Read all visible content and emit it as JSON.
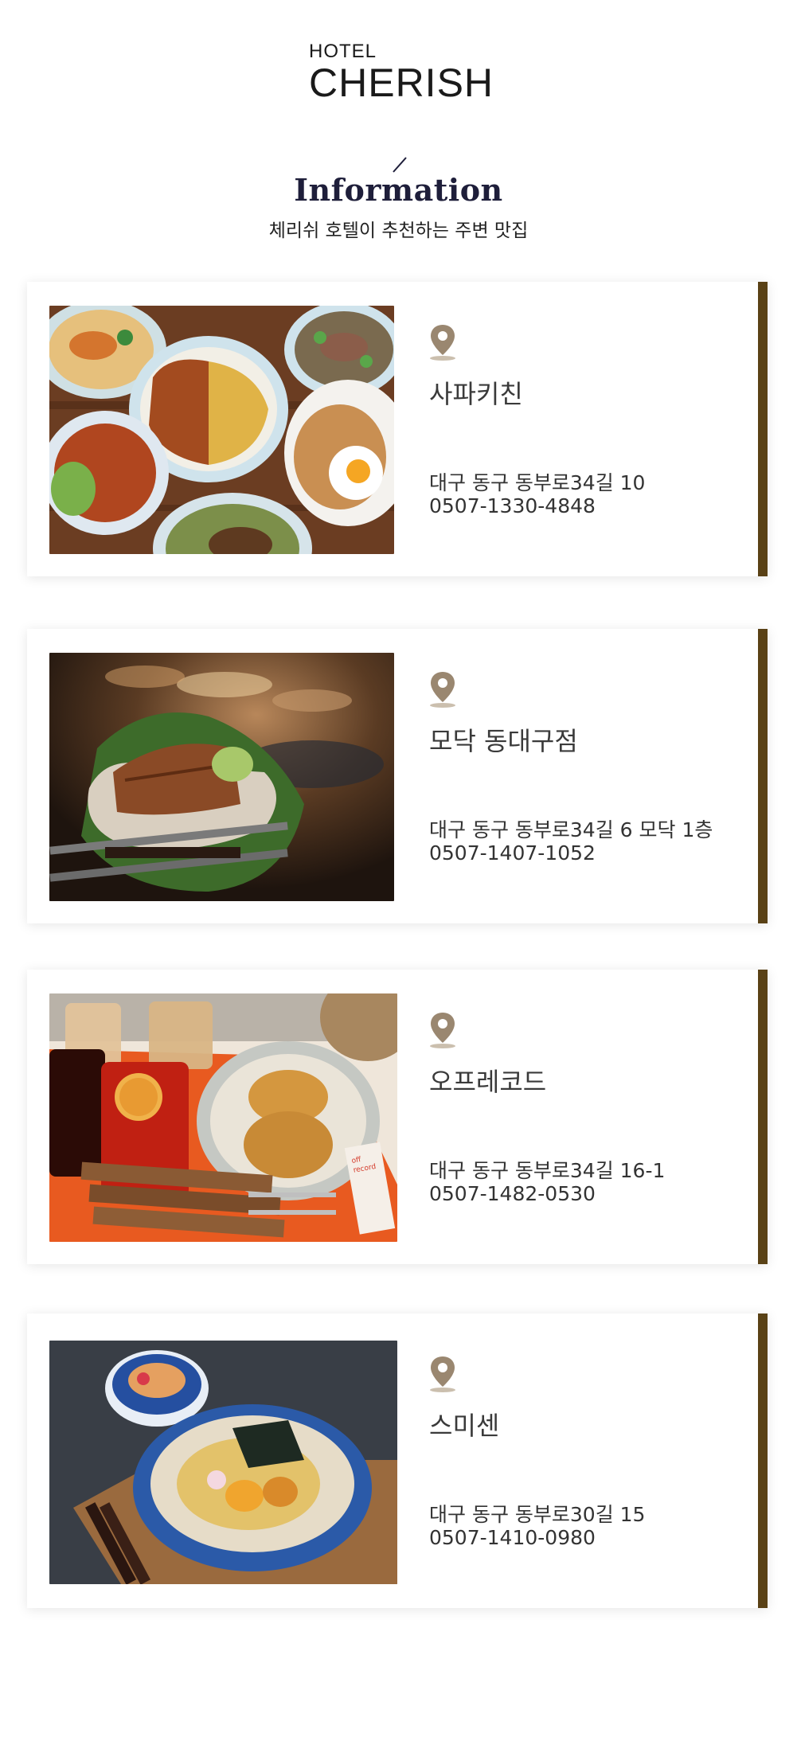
{
  "header": {
    "logo_small": "HOTEL",
    "logo_big": "CHERISH",
    "section_title": "Information",
    "section_subtitle": "체리쉬 호텔이 추천하는 주변 맛집"
  },
  "restaurants": [
    {
      "name": "사파키친",
      "address": "대구 동구 동부로34길 10",
      "phone": "0507-1330-4848"
    },
    {
      "name": "모닥 동대구점",
      "address": "대구 동구 동부로34길 6 모닥 1층",
      "phone": "0507-1407-1052"
    },
    {
      "name": "오프레코드",
      "address": "대구 동구 동부로34길 16-1",
      "phone": "0507-1482-0530"
    },
    {
      "name": "스미센",
      "address": "대구 동구 동부로30길 15",
      "phone": "0507-1410-0980"
    }
  ],
  "colors": {
    "accent_bar": "#5a4216",
    "pin": "#9a8770",
    "title": "#1e1e3a"
  },
  "icons": {
    "location": "map-pin-icon"
  }
}
